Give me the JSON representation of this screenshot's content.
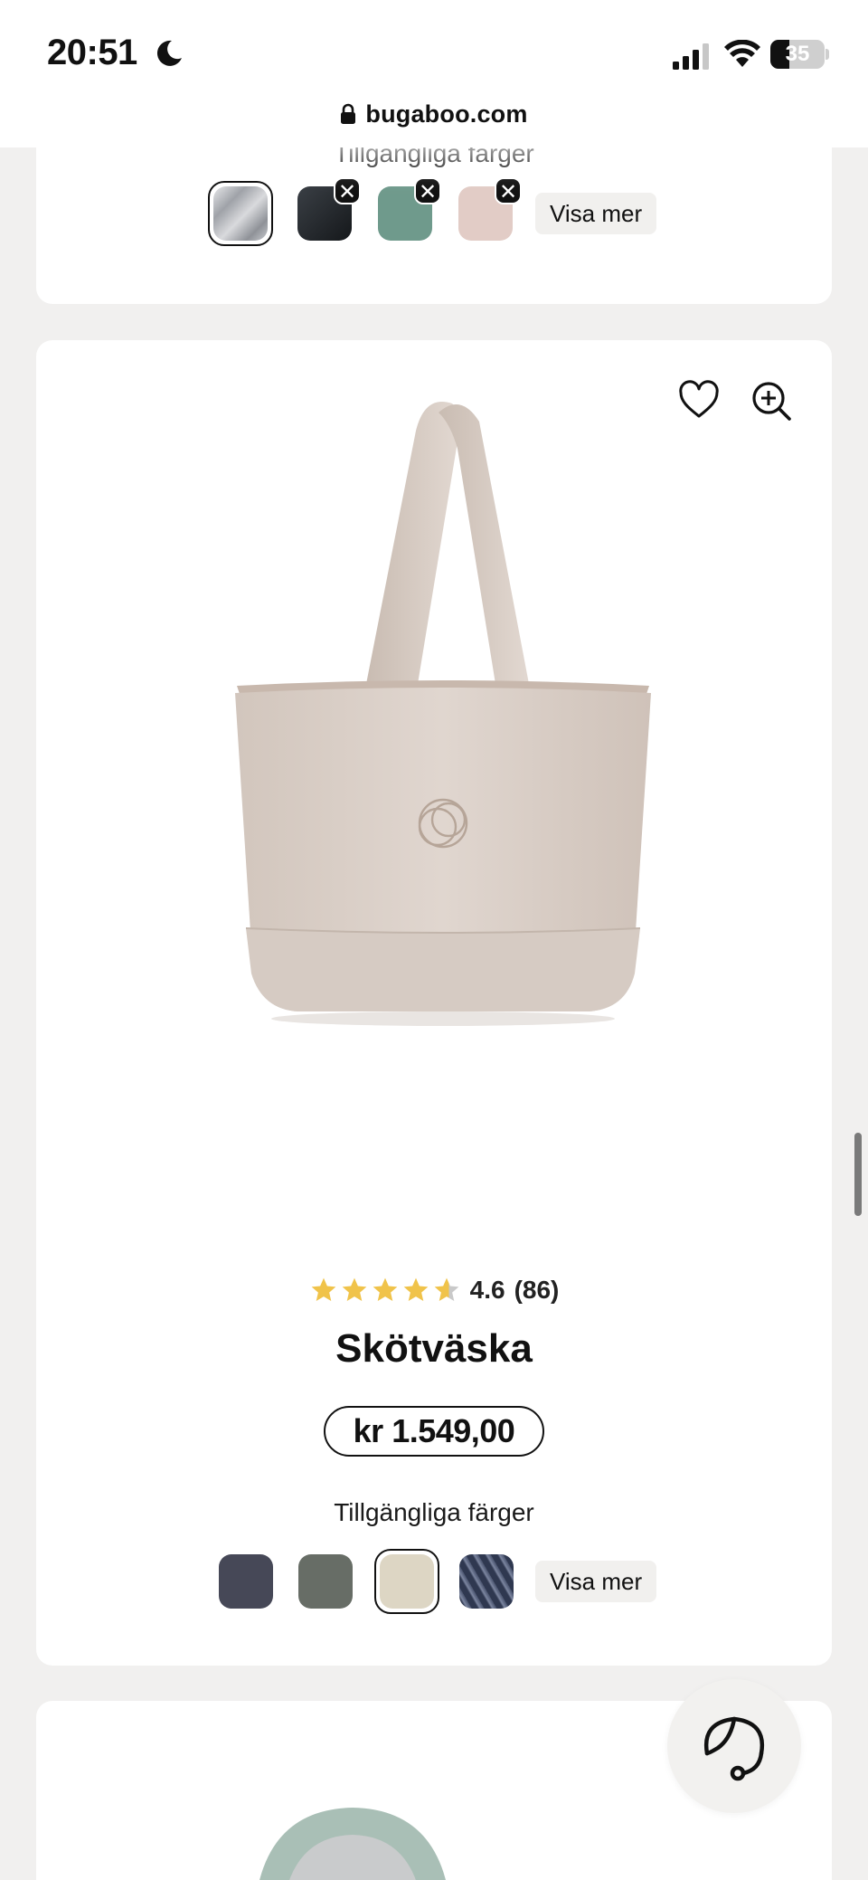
{
  "status_bar": {
    "time": "20:51",
    "battery": "35",
    "battery_level_percent": 35,
    "icons": [
      "moon-icon",
      "cellular-signal-icon",
      "wifi-icon",
      "battery-icon"
    ]
  },
  "browser": {
    "url": "bugaboo.com"
  },
  "previous_card": {
    "colors_label": "Tillgängliga färger",
    "swatches": [
      {
        "name": "grey-melange",
        "color": "#b9bbc0",
        "selected": true,
        "unavailable": false
      },
      {
        "name": "black",
        "color": "#22262b",
        "selected": false,
        "unavailable": true
      },
      {
        "name": "green",
        "color": "#6f9a8c",
        "selected": false,
        "unavailable": true
      },
      {
        "name": "pink",
        "color": "#e2ccc6",
        "selected": false,
        "unavailable": true
      }
    ],
    "show_more": "Visa mer"
  },
  "product": {
    "rating_value": "4.6",
    "rating_count": "(86)",
    "stars_filled": 4.6,
    "title": "Skötväska",
    "price": "kr 1.549,00",
    "colors_label": "Tillgängliga färger",
    "swatches": [
      {
        "name": "midnight-navy",
        "color": "#464857",
        "selected": false
      },
      {
        "name": "forest-green",
        "color": "#676d66",
        "selected": false
      },
      {
        "name": "desert-taupe",
        "color": "#ddd6c4",
        "selected": true
      },
      {
        "name": "blue-melange",
        "color": "#4a5470",
        "selected": false
      }
    ],
    "show_more": "Visa mer",
    "accent_star_color": "#f0c34a",
    "bag_color": "#dcd1c9"
  }
}
